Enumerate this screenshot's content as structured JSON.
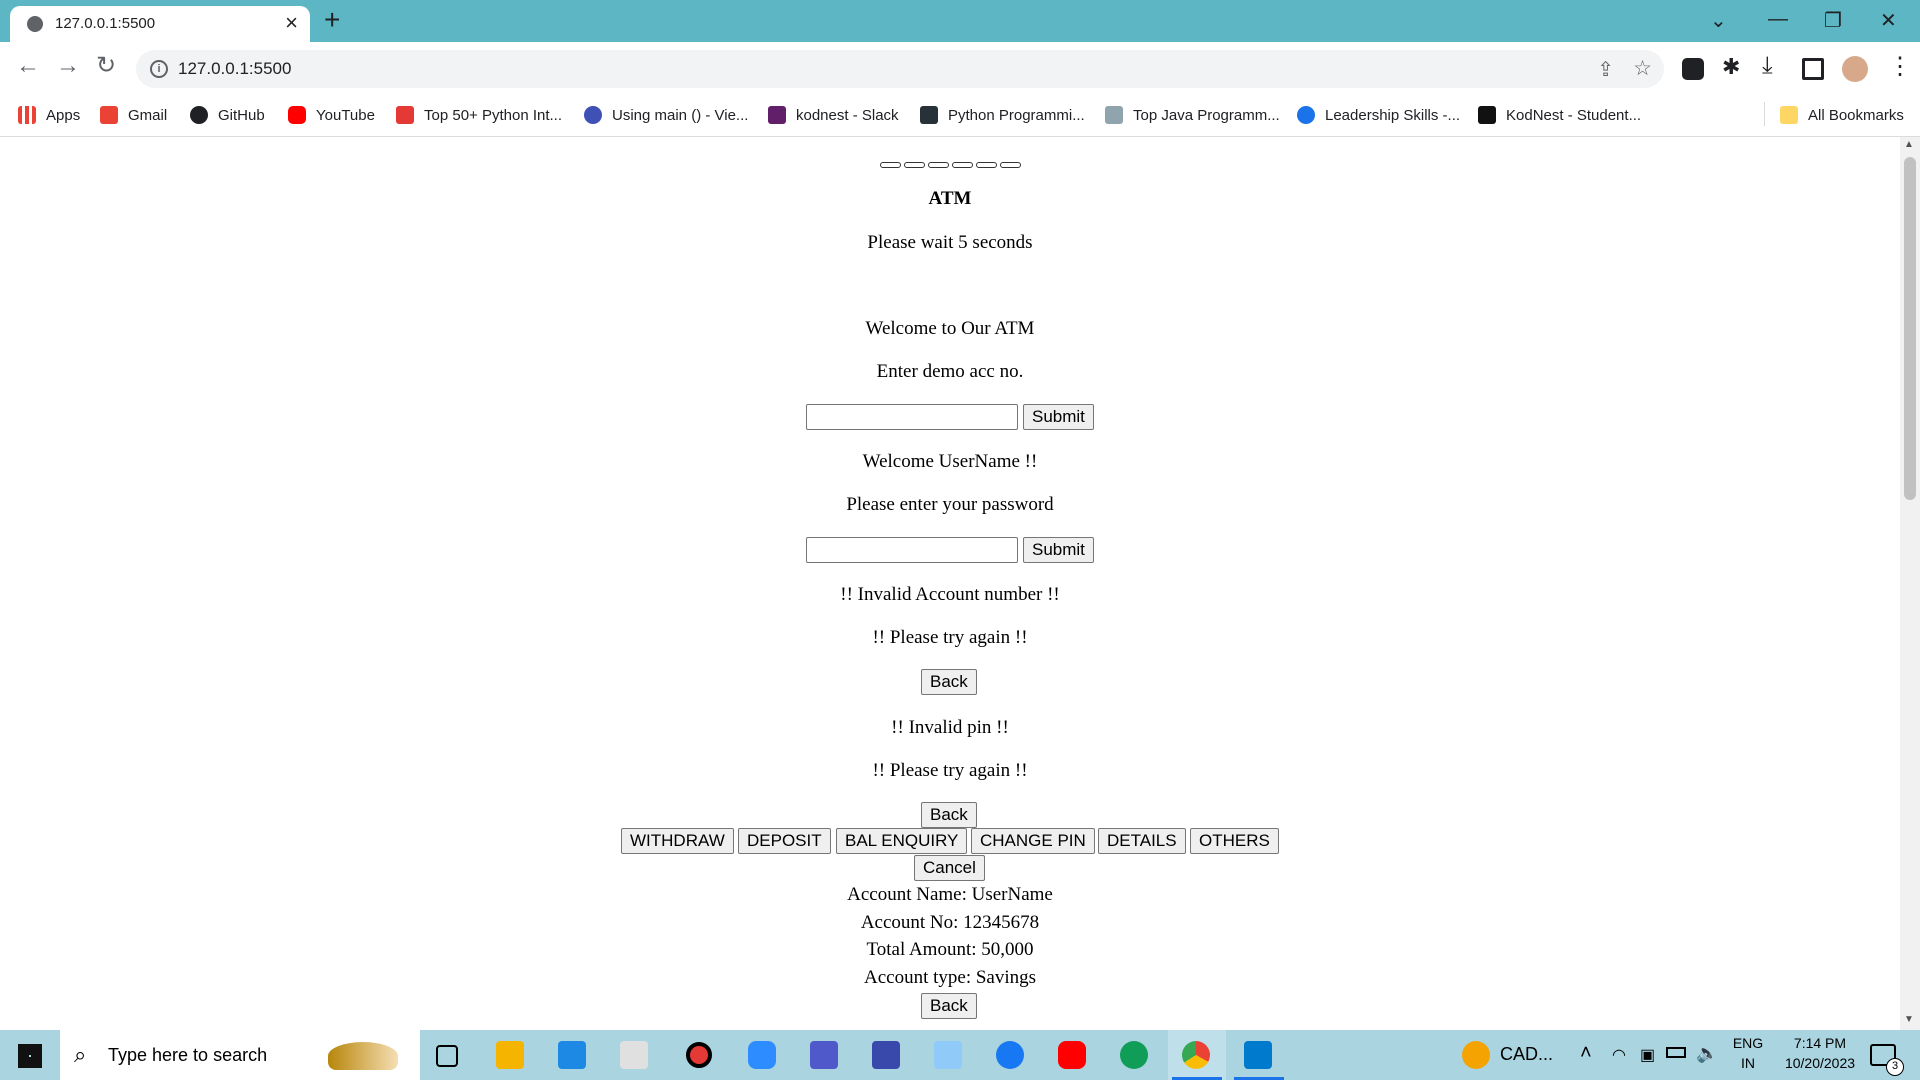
{
  "browser": {
    "tab_title": "127.0.0.1:5500",
    "new_tab_symbol": "+",
    "url": "127.0.0.1:5500"
  },
  "bookmarks": [
    {
      "label": "Apps",
      "icon": "apps-grid-icon",
      "color": "#ea4335"
    },
    {
      "label": "Gmail",
      "icon": "gmail-icon",
      "color": "#ea4335"
    },
    {
      "label": "GitHub",
      "icon": "github-icon",
      "color": "#202124"
    },
    {
      "label": "YouTube",
      "icon": "youtube-icon",
      "color": "#ff0000"
    },
    {
      "label": "Top 50+ Python Int...",
      "icon": "bookmark-favicon",
      "color": "#e53935"
    },
    {
      "label": "Using main () - Vie...",
      "icon": "bookmark-favicon",
      "color": "#3f51b5"
    },
    {
      "label": "kodnest - Slack",
      "icon": "slack-icon",
      "color": "#611f69"
    },
    {
      "label": "Python Programmi...",
      "icon": "bookmark-favicon",
      "color": "#263238"
    },
    {
      "label": "Top Java Programm...",
      "icon": "bookmark-favicon",
      "color": "#90a4ae"
    },
    {
      "label": "Leadership Skills -...",
      "icon": "bookmark-favicon",
      "color": "#1a73e8"
    },
    {
      "label": "KodNest - Student...",
      "icon": "kodnest-icon",
      "color": "#111111"
    }
  ],
  "all_bookmarks": "All Bookmarks",
  "atm": {
    "title": "ATM",
    "wait": "Please wait 5 seconds",
    "welcome": "Welcome to Our ATM",
    "enter_acc": "Enter demo acc no.",
    "submit1": "Submit",
    "welcome_user": "Welcome UserName !!",
    "enter_pw": "Please enter your password",
    "submit2": "Submit",
    "invalid_acc": "!! Invalid Account number !!",
    "try_again1": "!! Please try again !!",
    "back1": "Back",
    "invalid_pin": "!! Invalid pin !!",
    "try_again2": "!! Please try again !!",
    "back2": "Back",
    "menu": [
      "WITHDRAW",
      "DEPOSIT",
      "BAL ENQUIRY",
      "CHANGE PIN",
      "DETAILS",
      "OTHERS"
    ],
    "cancel": "Cancel",
    "acc_name": "Account Name: UserName",
    "acc_no": "Account No: 12345678",
    "total": "Total Amount: 50,000",
    "acc_type": "Account type: Savings",
    "back3": "Back"
  },
  "taskbar": {
    "search_placeholder": "Type here to search",
    "weather": "CAD...",
    "lang1": "ENG",
    "lang2": "IN",
    "time": "7:14 PM",
    "date": "10/20/2023",
    "notif_count": "3"
  }
}
